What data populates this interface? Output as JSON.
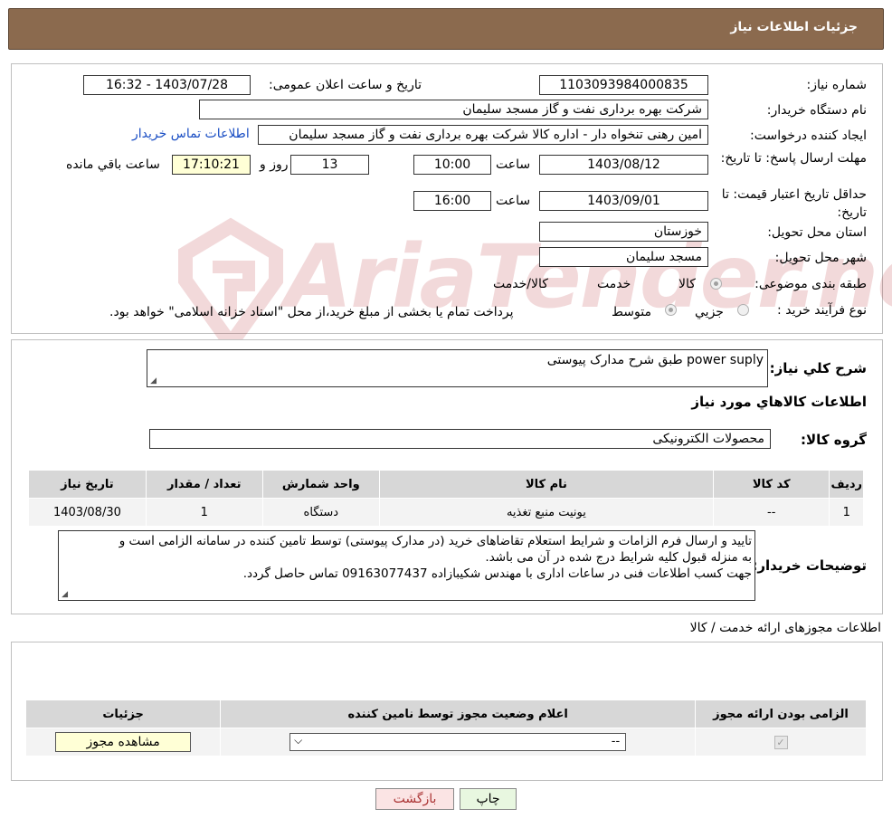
{
  "header": {
    "title": "جزئیات اطلاعات نیاز"
  },
  "info": {
    "need_number_label": "شماره نیاز:",
    "need_number": "1103093984000835",
    "announce_label": "تاریخ و ساعت اعلان عمومی:",
    "announce_value": "1403/07/28 - 16:32",
    "buyer_org_label": "نام دستگاه خریدار:",
    "buyer_org": "شرکت بهره برداری نفت و گاز مسجد سلیمان",
    "creator_label": "ایجاد کننده درخواست:",
    "creator": "امین رهنی تنخواه دار - اداره کالا  شرکت بهره برداری نفت و گاز مسجد سلیمان",
    "contact_link": "اطلاعات تماس خریدار",
    "deadline_label": "مهلت ارسال پاسخ: تا تاریخ:",
    "deadline_date": "1403/08/12",
    "time_label": "ساعت",
    "deadline_time": "10:00",
    "days_value": "13",
    "days_label": "روز و",
    "remaining_time": "17:10:21",
    "remaining_label": "ساعت باقي مانده",
    "validity_label": "حداقل تاریخ اعتبار قیمت: تا تاریخ:",
    "validity_date": "1403/09/01",
    "validity_time": "16:00",
    "province_label": "استان محل تحویل:",
    "province": "خوزستان",
    "city_label": "شهر محل تحویل:",
    "city": "مسجد سلیمان",
    "category_label": "طبقه بندی موضوعی:",
    "category_options": [
      "کالا",
      "خدمت",
      "کالا/خدمت"
    ],
    "process_label": "نوع فرآیند خرید :",
    "process_options": [
      "جزيي",
      "متوسط"
    ],
    "process_note": "پرداخت تمام یا بخشی از مبلغ خرید،از محل \"اسناد خزانه اسلامی\" خواهد بود."
  },
  "summary": {
    "label": "شرح کلي نياز:",
    "value": "power suply طبق شرح مدارک پیوستی",
    "goods_info_title": "اطلاعات کالاهاي مورد نياز",
    "group_label": "گروه کالا:",
    "group_value": "محصولات الکترونیکی"
  },
  "goods_table": {
    "headers": [
      "ردیف",
      "کد کالا",
      "نام کالا",
      "واحد شمارش",
      "تعداد / مقدار",
      "تاریخ نیاز"
    ],
    "rows": [
      [
        "1",
        "--",
        "یونیت منبع تغذیه",
        "دستگاه",
        "1",
        "1403/08/30"
      ]
    ]
  },
  "buyer_notes": {
    "label": "توضیحات خریدار:",
    "line1": "تایید و ارسال فرم الزامات و شرایط استعلام تقاضاهای خرید (در مدارک پیوستی) توسط تامین کننده در سامانه الزامی است و",
    "line2": "به منزله قبول کلیه شرایط درج شده در آن می باشد.",
    "line3": "جهت کسب اطلاعات فنی در ساعات اداری با مهندس شکیبازاده 09163077437 تماس حاصل گردد."
  },
  "permits": {
    "title": "اطلاعات مجوزهای ارائه خدمت / کالا",
    "headers": [
      "الزامی بودن ارائه مجوز",
      "اعلام وضعیت مجوز توسط نامین کننده",
      "جزئیات"
    ],
    "select_value": "--",
    "view_button": "مشاهده مجوز"
  },
  "actions": {
    "print": "چاپ",
    "back": "بازگشت"
  },
  "colors": {
    "header_bg": "#8b6a4e",
    "link": "#1a4ec4",
    "yellow_box": "#ffffd6",
    "print_btn": "#e8f7e0",
    "back_btn": "#fbe4e4"
  }
}
